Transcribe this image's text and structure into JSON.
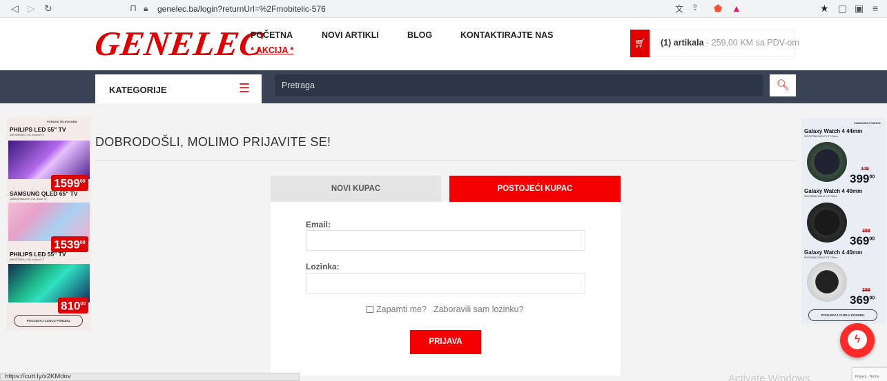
{
  "browser": {
    "url": "genelec.ba/login?returnUrl=%2Fmobitelic-576",
    "status_url": "https://cutt.ly/x2KMdov"
  },
  "header": {
    "logo": "GENELEC",
    "nav": [
      "POČETNA",
      "NOVI ARTIKLI",
      "BLOG",
      "KONTAKTIRAJTE NAS"
    ],
    "akcija": "* AKCIJA *",
    "cart_count": "(1) artikala",
    "cart_total": " - 259,00 KM sa PDV-om"
  },
  "categories": {
    "label": "KATEGORIJE"
  },
  "search": {
    "placeholder": "Pretraga"
  },
  "main": {
    "welcome": "DOBRODOŠLI, MOLIMO PRIJAVITE SE!",
    "tabs": [
      "NOVI KUPAC",
      "POSTOJEĆI KUPAC"
    ],
    "email_label": "Email:",
    "password_label": "Lozinka:",
    "email_value": "",
    "password_value": "",
    "remember": "Zapamti me?",
    "forgot": "Zaboravili sam lozinku?",
    "login_button": "PRIJAVA"
  },
  "ad_left": {
    "title": "PONUDA TELEVIZORA",
    "items": [
      {
        "name": "PHILIPS LED 55\" TV",
        "sub": "55PUS8506/12 | 4K, Android TV",
        "price": "1599",
        "cents": "00"
      },
      {
        "name": "SAMSUNG QLED 65\" TV",
        "sub": "QE65Q67BAUXXH | 4K, Smart TV",
        "price": "1539",
        "cents": "00"
      },
      {
        "name": "PHILIPS LED 55\" TV",
        "sub": "55PUS7506/12 | 4K, Android TV",
        "price": "810",
        "cents": "00"
      }
    ],
    "button": "POGLEDAJ CIJELU PONUDU"
  },
  "ad_right": {
    "title": "SAMSUNG PONUDA",
    "items": [
      {
        "name": "Galaxy Watch 4 44mm",
        "sub": "SM-R870NZKAEUF | BT Green",
        "old": "449",
        "price": "399",
        "cents": "00"
      },
      {
        "name": "Galaxy Watch 4 40mm",
        "sub": "SM-R860NZKAEUF | BT Black",
        "old": "399",
        "price": "369",
        "cents": "00"
      },
      {
        "name": "Galaxy Watch 4 40mm",
        "sub": "SM-R860NZSAEUF | BT Silver",
        "old": "399",
        "price": "369",
        "cents": "00"
      }
    ],
    "button": "POGLEDAJ CIJELU PONUDU"
  },
  "overlay": {
    "activate": "Activate Windows",
    "recaptcha": "Privacy - Terms"
  },
  "colors": {
    "accent": "#e00000",
    "dark_bar": "#3a4456"
  }
}
